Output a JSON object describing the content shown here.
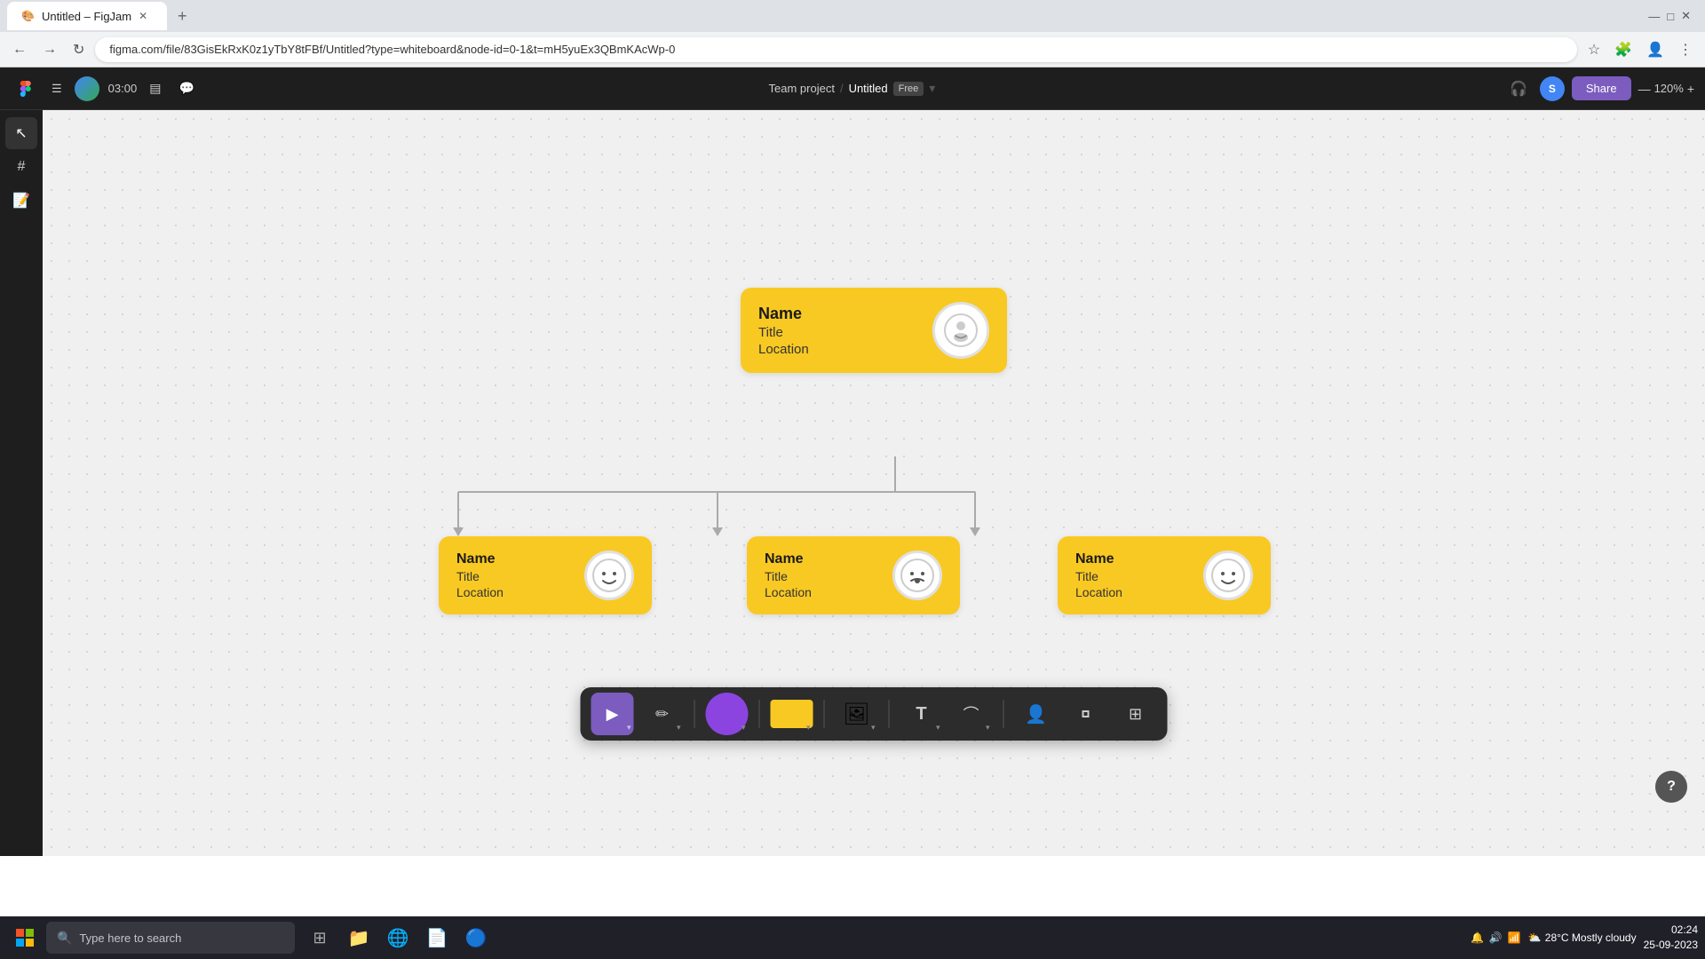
{
  "browser": {
    "tab_title": "Untitled – FigJam",
    "address": "figma.com/file/83GisEkRxK0z1yTbY8tFBf/Untitled?type=whiteboard&node-id=0-1&t=mH5yuEx3QBmKAcWp-0",
    "nav_back": "←",
    "nav_forward": "→",
    "nav_refresh": "↻"
  },
  "figma": {
    "timer": "03:00",
    "project": "Team project",
    "separator": "/",
    "filename": "Untitled",
    "free_label": "Free",
    "share_label": "Share",
    "zoom": "120%",
    "user_initial": "S"
  },
  "org_chart": {
    "root": {
      "name": "Name",
      "title": "Title",
      "location": "Location"
    },
    "children": [
      {
        "name": "Name",
        "title": "Title",
        "location": "Location",
        "face": "happy"
      },
      {
        "name": "Name",
        "title": "Title",
        "location": "Location",
        "face": "neutral"
      },
      {
        "name": "Name",
        "title": "Title",
        "location": "Location",
        "face": "happy"
      }
    ]
  },
  "toolbar": {
    "cursor_label": "▶",
    "pen_label": "✏",
    "text_label": "T",
    "connector_label": "⌒",
    "person_label": "👤",
    "frame_label": "▭",
    "table_label": "⊞"
  },
  "taskbar": {
    "search_placeholder": "Type here to search",
    "time": "02:24",
    "date": "25-09-2023",
    "weather": "28°C Mostly cloudy"
  }
}
